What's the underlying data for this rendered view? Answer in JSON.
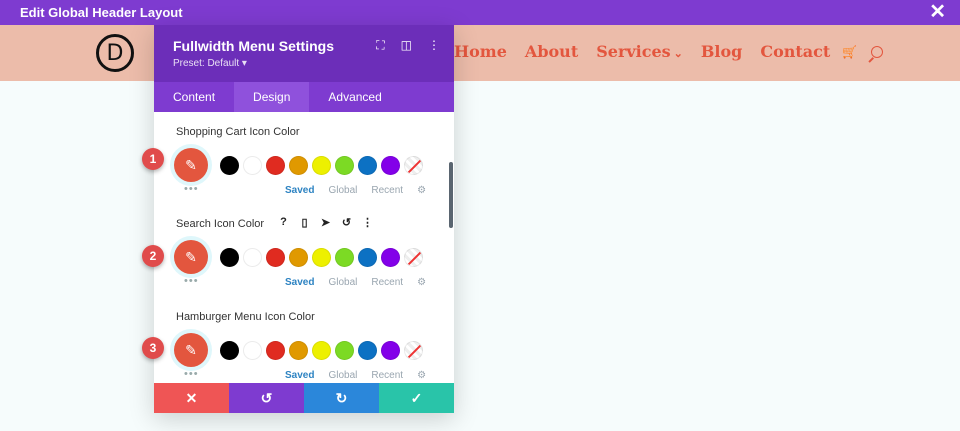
{
  "topbar": {
    "title": "Edit Global Header Layout",
    "close": "✕"
  },
  "header": {
    "logo": "D",
    "nav": [
      {
        "label": "Home",
        "chevron": ""
      },
      {
        "label": "About",
        "chevron": ""
      },
      {
        "label": "Services",
        "chevron": "⌄"
      },
      {
        "label": "Blog",
        "chevron": ""
      },
      {
        "label": "Contact",
        "chevron": ""
      }
    ],
    "cart": "🛒"
  },
  "panel": {
    "title": "Fullwidth Menu Settings",
    "preset": "Preset: Default ▾",
    "icons": {
      "expand": "⛶",
      "split": "◫",
      "more": "⋮"
    },
    "tabs": [
      "Content",
      "Design",
      "Advanced"
    ],
    "groups": [
      {
        "label": "Shopping Cart Icon Color",
        "marker": "1"
      },
      {
        "label": "Search Icon Color",
        "marker": "2"
      },
      {
        "label": "Hamburger Menu Icon Color",
        "marker": "3"
      }
    ],
    "tools": {
      "help": "?",
      "mobile": "▯",
      "cursor": "➤",
      "reset": "↺",
      "more": "⋮"
    },
    "palette": [
      "#000000",
      "#ffffff",
      "#e02b20",
      "#e09900",
      "#edf000",
      "#7cda24",
      "#0c71c3",
      "#8300e9"
    ],
    "picker_color": "#e3563e",
    "picker_icon": "✎",
    "dots": "•••",
    "palette_links": {
      "saved": "Saved",
      "global": "Global",
      "recent": "Recent",
      "gear": "⚙"
    },
    "footer": {
      "cancel": "✕",
      "undo": "↺",
      "redo": "↻",
      "save": "✓",
      "colors": [
        "#ef5555",
        "#7e3bd0",
        "#2b87da",
        "#29c4a9"
      ]
    }
  },
  "colors": {
    "accent": "#7e3bd0",
    "nav": "#e3563e",
    "header_bg": "#ecbcaa"
  }
}
